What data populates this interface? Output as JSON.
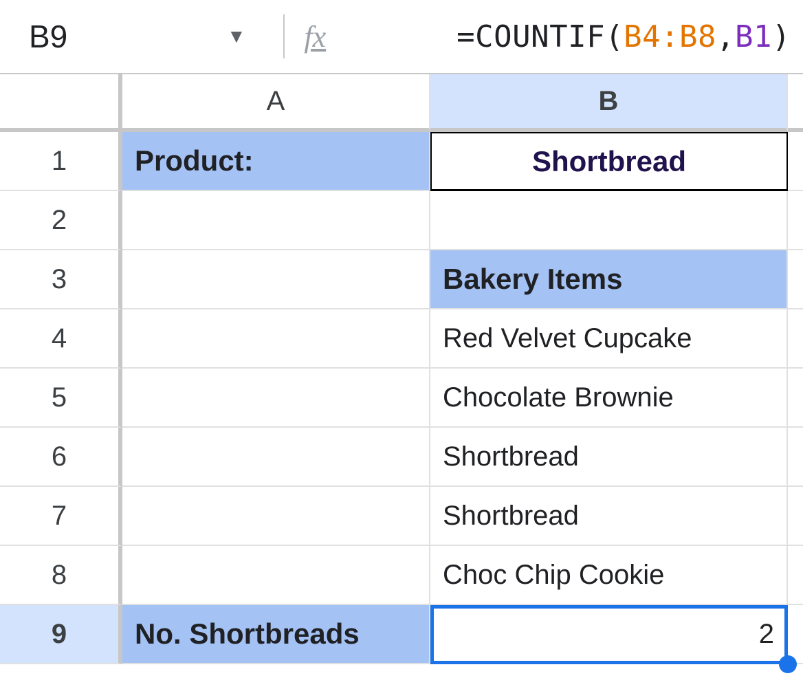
{
  "name_box": {
    "value": "B9"
  },
  "fx_label": "fx",
  "formula": {
    "eq": "=",
    "func": "COUNTIF",
    "open": "(",
    "range": "B4:B8",
    "comma": ",",
    "ref": "B1",
    "close": ")"
  },
  "columns": {
    "A": "A",
    "B": "B"
  },
  "rows": {
    "1": "1",
    "2": "2",
    "3": "3",
    "4": "4",
    "5": "5",
    "6": "6",
    "7": "7",
    "8": "8",
    "9": "9"
  },
  "cells": {
    "A1": "Product:",
    "B1": "Shortbread",
    "B3": "Bakery Items",
    "B4": "Red Velvet Cupcake",
    "B5": "Chocolate Brownie",
    "B6": "Shortbread",
    "B7": "Shortbread",
    "B8": "Choc Chip Cookie",
    "A9": "No. Shortbreads",
    "B9": "2"
  },
  "selected_cell": "B9",
  "selected_column": "B",
  "selected_row": "9"
}
